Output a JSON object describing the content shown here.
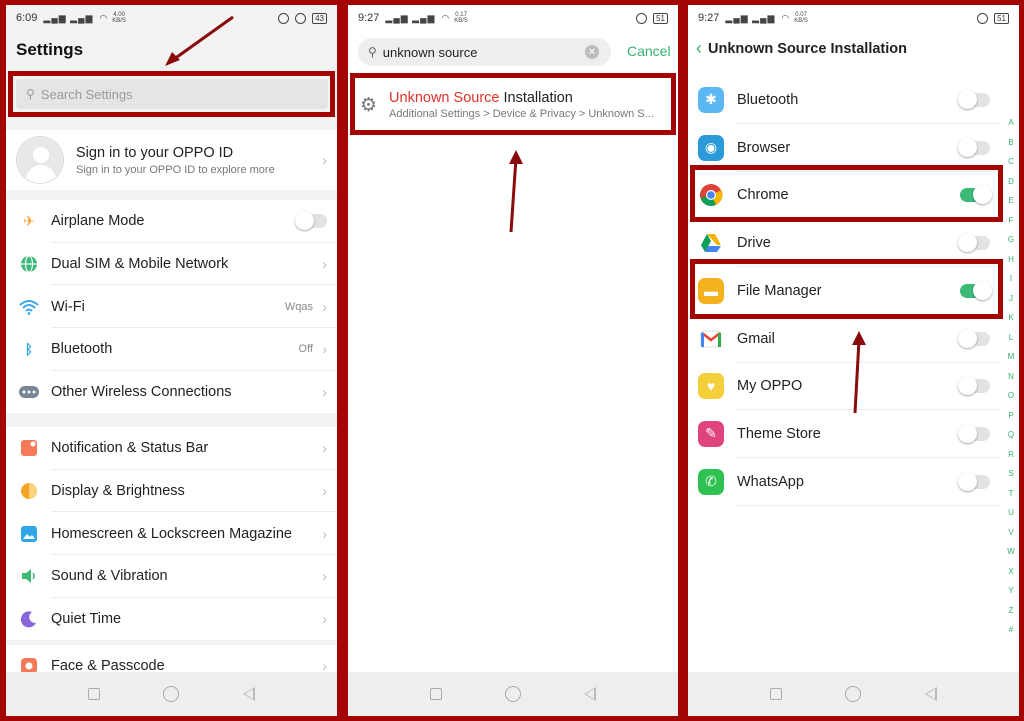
{
  "panels": {
    "settings": {
      "status": {
        "time": "6:09",
        "speed": [
          "4.00",
          "KB/S"
        ],
        "battery": "43"
      },
      "title": "Settings",
      "search_placeholder": "Search Settings",
      "account": {
        "title": "Sign in to your OPPO ID",
        "subtitle": "Sign in to your OPPO ID to explore more"
      },
      "group1": [
        {
          "label": "Airplane Mode",
          "icon": "airplane-icon"
        },
        {
          "label": "Dual SIM & Mobile Network",
          "icon": "globe-icon"
        },
        {
          "label": "Wi-Fi",
          "value": "Wqas",
          "icon": "wifi-icon"
        },
        {
          "label": "Bluetooth",
          "value": "Off",
          "icon": "bluetooth-icon"
        },
        {
          "label": "Other Wireless Connections",
          "icon": "dots-icon"
        }
      ],
      "group2": [
        {
          "label": "Notification & Status Bar",
          "icon": "notification-icon"
        },
        {
          "label": "Display & Brightness",
          "icon": "brightness-icon"
        },
        {
          "label": "Homescreen & Lockscreen Magazine",
          "icon": "image-icon"
        },
        {
          "label": "Sound & Vibration",
          "icon": "speaker-icon"
        },
        {
          "label": "Quiet Time",
          "icon": "moon-icon"
        }
      ],
      "group3": [
        {
          "label": "Face & Passcode",
          "icon": "face-icon"
        }
      ]
    },
    "search": {
      "status": {
        "time": "9:27",
        "speed": [
          "0.17",
          "KB/S"
        ],
        "battery": "51"
      },
      "query": "unknown source",
      "cancel_label": "Cancel",
      "result": {
        "highlight": "Unknown Source",
        "rest": " Installation",
        "path": "Additional Settings > Device & Privacy > Unknown S..."
      }
    },
    "unknown_sources": {
      "status": {
        "time": "9:27",
        "speed": [
          "0.07",
          "KB/S"
        ],
        "battery": "51"
      },
      "title": "Unknown Source Installation",
      "apps": [
        {
          "name": "Bluetooth",
          "enabled": false,
          "color": "#5bb8f5",
          "glyph": "✱"
        },
        {
          "name": "Browser",
          "enabled": false,
          "color": "#2a9bd8",
          "glyph": "◉"
        },
        {
          "name": "Chrome",
          "enabled": true,
          "color": "#ffffff",
          "glyph": ""
        },
        {
          "name": "Drive",
          "enabled": false,
          "color": "#ffffff",
          "glyph": ""
        },
        {
          "name": "File Manager",
          "enabled": true,
          "color": "#f5b21f",
          "glyph": "▬"
        },
        {
          "name": "Gmail",
          "enabled": false,
          "color": "#ffffff",
          "glyph": "M"
        },
        {
          "name": "My OPPO",
          "enabled": false,
          "color": "#f3cf3a",
          "glyph": "♥"
        },
        {
          "name": "Theme Store",
          "enabled": false,
          "color": "#e0447f",
          "glyph": "✎"
        },
        {
          "name": "WhatsApp",
          "enabled": false,
          "color": "#2fc152",
          "glyph": "✆"
        }
      ],
      "alphabet": [
        "A",
        "B",
        "C",
        "D",
        "E",
        "F",
        "G",
        "H",
        "I",
        "J",
        "K",
        "L",
        "M",
        "N",
        "O",
        "P",
        "Q",
        "R",
        "S",
        "T",
        "U",
        "V",
        "W",
        "X",
        "Y",
        "Z",
        "#"
      ]
    }
  },
  "colors": {
    "accent": "#35b26e",
    "highlight_frame": "#a30505",
    "toggle_on": "#3cba78"
  }
}
